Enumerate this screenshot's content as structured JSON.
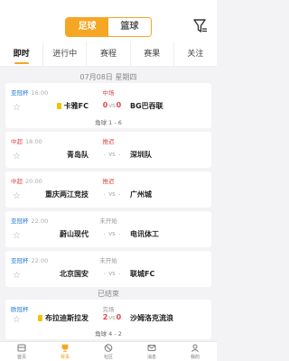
{
  "header": {
    "segment": {
      "active": "足球",
      "inactive": "篮球"
    }
  },
  "tabs": [
    {
      "label": "即时",
      "active": true
    },
    {
      "label": "进行中"
    },
    {
      "label": "赛程"
    },
    {
      "label": "赛果"
    },
    {
      "label": "关注"
    }
  ],
  "date_header": "07月08日 星期四",
  "matches": [
    {
      "league": "亚冠杯",
      "time": "16:00",
      "status": "中场",
      "home": "卡雅FC",
      "home_score": "0",
      "away_score": "0",
      "vs": "VS",
      "away": "BG巴吞联",
      "sub": "角球 1 - 6"
    },
    {
      "league": "中超",
      "time": "18:00",
      "status": "推迟",
      "home": "青岛队",
      "vs": "VS",
      "away": "深圳队"
    },
    {
      "league": "中超",
      "time": "20:00",
      "status": "推迟",
      "home": "重庆两江竞技",
      "vs": "VS",
      "away": "广州城"
    },
    {
      "league": "亚冠杯",
      "time": "22:00",
      "status": "未开始",
      "home": "蔚山现代",
      "vs": "VS",
      "away": "电讯体工"
    },
    {
      "league": "亚冠杯",
      "time": "22:00",
      "status": "未开始",
      "home": "北京国安",
      "vs": "VS",
      "away": "联城FC"
    }
  ],
  "ended_header": "已结束",
  "ended_match": {
    "league": "欧冠杯",
    "time": "",
    "status": "完场",
    "home": "布拉迪斯拉发",
    "home_score": "2",
    "away_score": "0",
    "vs": "VS",
    "away": "沙姆洛克流浪",
    "sub": "角球 4 - 2"
  },
  "bottom_nav": [
    {
      "label": "首页"
    },
    {
      "label": "赛事",
      "active": true
    },
    {
      "label": "社区"
    },
    {
      "label": "消息"
    },
    {
      "label": "我的"
    }
  ],
  "colors": {
    "accent": "#f5a623",
    "league_blue": "#1e78d7",
    "league_red": "#e04545"
  }
}
